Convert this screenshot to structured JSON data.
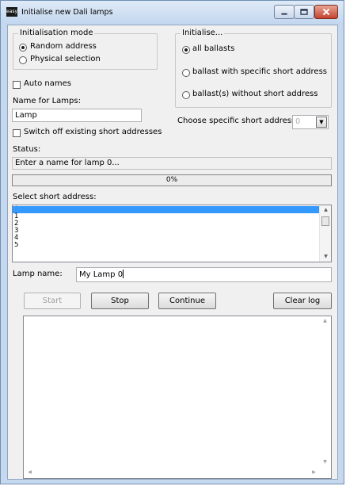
{
  "window": {
    "title": "Initialise new Dali lamps",
    "app_icon_text": "easy"
  },
  "init_mode": {
    "legend": "Initialisation mode",
    "options": [
      {
        "label": "Random address",
        "checked": true
      },
      {
        "label": "Physical selection",
        "checked": false
      }
    ]
  },
  "initialise": {
    "legend": "Initialise...",
    "options": [
      {
        "label": "all ballasts",
        "checked": true
      },
      {
        "label": "ballast with specific short address",
        "checked": false
      },
      {
        "label": "ballast(s) without short address",
        "checked": false
      }
    ]
  },
  "auto_names": {
    "label": "Auto names",
    "checked": false
  },
  "name_for_lamps": {
    "label": "Name for Lamps:",
    "value": "Lamp"
  },
  "switch_off": {
    "label": "Switch off existing short addresses",
    "checked": false
  },
  "specific_address": {
    "label": "Choose specific short address:",
    "value": "0"
  },
  "status": {
    "label": "Status:",
    "value": "Enter a name for lamp 0..."
  },
  "progress": {
    "text": "0%",
    "percent": 0
  },
  "select_address": {
    "label": "Select short address:",
    "items": [
      "0",
      "1",
      "2",
      "3",
      "4",
      "5"
    ],
    "selected_index": 0
  },
  "lamp_name": {
    "label": "Lamp name:",
    "value": "My Lamp 0"
  },
  "buttons": {
    "start": "Start",
    "stop": "Stop",
    "continue": "Continue",
    "clear_log": "Clear log"
  },
  "log": {
    "value": ""
  },
  "colors": {
    "selection": "#3399ff",
    "window_frame": "#c6d8ee",
    "close_button": "#c4432f",
    "dialog_bg": "#f0f0f0"
  }
}
